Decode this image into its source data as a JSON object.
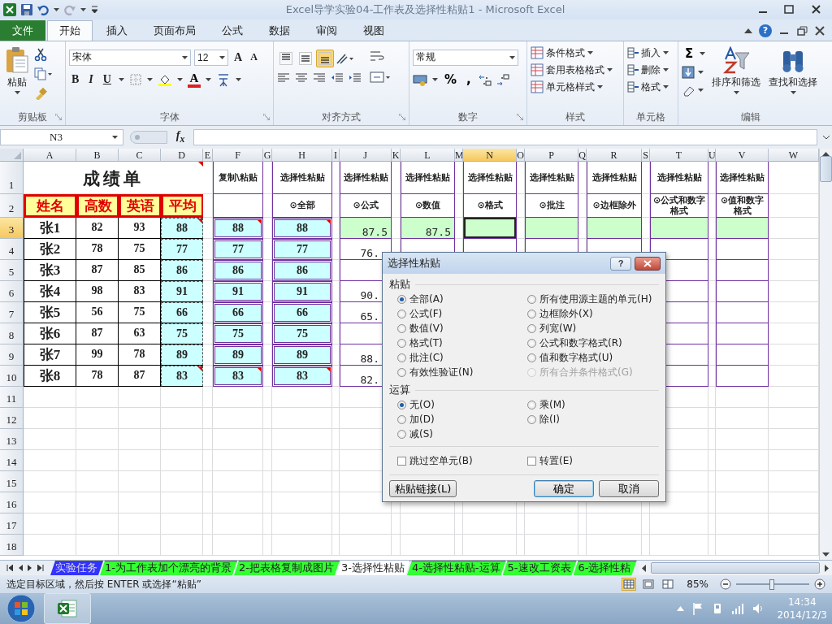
{
  "window": {
    "title": "Excel导学实验04-工作表及选择性粘贴1 - Microsoft Excel"
  },
  "ribbon_tabs": [
    {
      "label": "文件",
      "kind": "file",
      "selected": false
    },
    {
      "label": "开始",
      "kind": "tab",
      "selected": true
    },
    {
      "label": "插入",
      "kind": "tab",
      "selected": false
    },
    {
      "label": "页面布局",
      "kind": "tab",
      "selected": false
    },
    {
      "label": "公式",
      "kind": "tab",
      "selected": false
    },
    {
      "label": "数据",
      "kind": "tab",
      "selected": false
    },
    {
      "label": "审阅",
      "kind": "tab",
      "selected": false
    },
    {
      "label": "视图",
      "kind": "tab",
      "selected": false
    }
  ],
  "help": "?",
  "ribbon": {
    "clipboard": {
      "label": "剪贴板",
      "paste": "粘贴"
    },
    "font": {
      "label": "字体",
      "font_name": "宋体",
      "font_size": "12",
      "grow": "A",
      "shrink": "A",
      "bold": "B",
      "italic": "I",
      "underline": "U",
      "font_color": "A"
    },
    "alignment": {
      "label": "对齐方式",
      "vertical": [
        {
          "kind": "top",
          "selected": false
        },
        {
          "kind": "middle",
          "selected": false
        },
        {
          "kind": "bottom",
          "selected": true
        }
      ]
    },
    "number": {
      "label": "数字",
      "format": "常规",
      "percent": "%",
      "comma": ","
    },
    "styles": {
      "label": "样式",
      "items": [
        "条件格式",
        "套用表格格式",
        "单元格样式"
      ]
    },
    "cells": {
      "label": "单元格",
      "items": [
        "插入",
        "删除",
        "格式"
      ]
    },
    "editing": {
      "label": "编辑",
      "sum": "Σ",
      "sort": "排序和筛选",
      "find": "查找和选择"
    }
  },
  "formula_bar": {
    "name_box": "N3",
    "fx": "f$_{x}$"
  },
  "sheet": {
    "columns": [
      {
        "label": "A",
        "selected": false
      },
      {
        "label": "B",
        "selected": false
      },
      {
        "label": "C",
        "selected": false
      },
      {
        "label": "D",
        "selected": false
      },
      {
        "label": "E",
        "selected": false
      },
      {
        "label": "F",
        "selected": false
      },
      {
        "label": "G",
        "selected": false
      },
      {
        "label": "H",
        "selected": false
      },
      {
        "label": "I",
        "selected": false
      },
      {
        "label": "J",
        "selected": false
      },
      {
        "label": "K",
        "selected": false
      },
      {
        "label": "L",
        "selected": false
      },
      {
        "label": "M",
        "selected": false
      },
      {
        "label": "N",
        "selected": true
      },
      {
        "label": "O",
        "selected": false
      },
      {
        "label": "P",
        "selected": false
      },
      {
        "label": "Q",
        "selected": false
      },
      {
        "label": "R",
        "selected": false
      },
      {
        "label": "S",
        "selected": false
      },
      {
        "label": "T",
        "selected": false
      },
      {
        "label": "U",
        "selected": false
      },
      {
        "label": "V",
        "selected": false
      },
      {
        "label": "W",
        "selected": false
      }
    ],
    "rows": [
      {
        "label": "1",
        "selected": false,
        "cells": [
          {
            "kind": "title",
            "text": "成绩单",
            "comment": true
          },
          {
            "kind": "blank"
          },
          {
            "kind": "label",
            "text": "复制\\粘贴"
          },
          {
            "kind": "blank"
          },
          {
            "kind": "label",
            "text": "选择性粘贴"
          },
          {
            "kind": "blank"
          },
          {
            "kind": "label",
            "text": "选择性粘贴"
          },
          {
            "kind": "blank"
          },
          {
            "kind": "label",
            "text": "选择性粘贴"
          },
          {
            "kind": "blank"
          },
          {
            "kind": "label",
            "text": "选择性粘贴"
          },
          {
            "kind": "blank"
          },
          {
            "kind": "label",
            "text": "选择性粘贴"
          },
          {
            "kind": "blank"
          },
          {
            "kind": "label",
            "text": "选择性粘贴"
          },
          {
            "kind": "blank"
          },
          {
            "kind": "label",
            "text": "选择性粘贴"
          },
          {
            "kind": "blank"
          },
          {
            "kind": "label",
            "text": "选择性粘贴"
          },
          {
            "kind": "blank"
          }
        ]
      },
      {
        "label": "2",
        "selected": false,
        "cells": [
          {
            "kind": "header",
            "text": "姓名"
          },
          {
            "kind": "header",
            "text": "高数"
          },
          {
            "kind": "header",
            "text": "英语"
          },
          {
            "kind": "header",
            "text": "平均"
          },
          {
            "kind": "blank"
          },
          {
            "kind": "box"
          },
          {
            "kind": "blank"
          },
          {
            "kind": "option",
            "text": "⊙全部"
          },
          {
            "kind": "blank"
          },
          {
            "kind": "option",
            "text": "⊙公式"
          },
          {
            "kind": "blank"
          },
          {
            "kind": "option",
            "text": "⊙数值"
          },
          {
            "kind": "blank"
          },
          {
            "kind": "option",
            "text": "⊙格式"
          },
          {
            "kind": "blank"
          },
          {
            "kind": "option",
            "text": "⊙批注"
          },
          {
            "kind": "blank"
          },
          {
            "kind": "option",
            "text": "⊙边框除外"
          },
          {
            "kind": "blank"
          },
          {
            "kind": "option",
            "text": "⊙公式和数字格式"
          },
          {
            "kind": "blank"
          },
          {
            "kind": "option",
            "text": "⊙值和数字格式"
          },
          {
            "kind": "blank"
          }
        ]
      },
      {
        "label": "3",
        "selected": true,
        "cells": [
          {
            "kind": "name",
            "text": "张1"
          },
          {
            "kind": "score",
            "text": "82"
          },
          {
            "kind": "score",
            "text": "93"
          },
          {
            "kind": "avg",
            "text": "88",
            "comment": true
          },
          {
            "kind": "blank"
          },
          {
            "kind": "copy",
            "text": "88",
            "comment": true
          },
          {
            "kind": "blank"
          },
          {
            "kind": "copy",
            "text": "88",
            "comment": true
          },
          {
            "kind": "blank"
          },
          {
            "kind": "green",
            "text": "87.5"
          },
          {
            "kind": "blank"
          },
          {
            "kind": "green",
            "text": "87.5"
          },
          {
            "kind": "blank"
          },
          {
            "kind": "green"
          },
          {
            "kind": "blank"
          },
          {
            "kind": "green"
          },
          {
            "kind": "blank"
          },
          {
            "kind": "green"
          },
          {
            "kind": "blank"
          },
          {
            "kind": "green"
          },
          {
            "kind": "blank"
          },
          {
            "kind": "green"
          },
          {
            "kind": "blank"
          }
        ]
      },
      {
        "label": "4",
        "selected": false,
        "cells": [
          {
            "kind": "name",
            "text": "张2"
          },
          {
            "kind": "score",
            "text": "78"
          },
          {
            "kind": "score",
            "text": "75"
          },
          {
            "kind": "avg",
            "text": "77",
            "comment": false
          },
          {
            "kind": "blank"
          },
          {
            "kind": "copy",
            "text": "77",
            "comment": false
          },
          {
            "kind": "blank"
          },
          {
            "kind": "copy",
            "text": "77",
            "comment": false
          },
          {
            "kind": "blank"
          },
          {
            "kind": "number",
            "text": "76."
          },
          {
            "kind": "blank"
          },
          {
            "kind": "box"
          },
          {
            "kind": "blank"
          },
          {
            "kind": "box"
          },
          {
            "kind": "blank"
          },
          {
            "kind": "box"
          },
          {
            "kind": "blank"
          },
          {
            "kind": "box"
          },
          {
            "kind": "blank"
          },
          {
            "kind": "box"
          },
          {
            "kind": "blank"
          },
          {
            "kind": "box"
          },
          {
            "kind": "blank"
          }
        ]
      },
      {
        "label": "5",
        "selected": false,
        "cells": [
          {
            "kind": "name",
            "text": "张3"
          },
          {
            "kind": "score",
            "text": "87"
          },
          {
            "kind": "score",
            "text": "85"
          },
          {
            "kind": "avg",
            "text": "86",
            "comment": false
          },
          {
            "kind": "blank"
          },
          {
            "kind": "copy",
            "text": "86",
            "comment": false
          },
          {
            "kind": "blank"
          },
          {
            "kind": "copy",
            "text": "86",
            "comment": false
          },
          {
            "kind": "blank"
          },
          {
            "kind": "box"
          },
          {
            "kind": "blank"
          },
          {
            "kind": "box"
          },
          {
            "kind": "blank"
          },
          {
            "kind": "box"
          },
          {
            "kind": "blank"
          },
          {
            "kind": "box"
          },
          {
            "kind": "blank"
          },
          {
            "kind": "box"
          },
          {
            "kind": "blank"
          },
          {
            "kind": "box"
          },
          {
            "kind": "blank"
          },
          {
            "kind": "box"
          },
          {
            "kind": "blank"
          }
        ]
      },
      {
        "label": "6",
        "selected": false,
        "cells": [
          {
            "kind": "name",
            "text": "张4"
          },
          {
            "kind": "score",
            "text": "98"
          },
          {
            "kind": "score",
            "text": "83"
          },
          {
            "kind": "avg",
            "text": "91",
            "comment": false
          },
          {
            "kind": "blank"
          },
          {
            "kind": "copy",
            "text": "91",
            "comment": false
          },
          {
            "kind": "blank"
          },
          {
            "kind": "copy",
            "text": "91",
            "comment": false
          },
          {
            "kind": "blank"
          },
          {
            "kind": "number",
            "text": "90."
          },
          {
            "kind": "blank"
          },
          {
            "kind": "box"
          },
          {
            "kind": "blank"
          },
          {
            "kind": "box"
          },
          {
            "kind": "blank"
          },
          {
            "kind": "box"
          },
          {
            "kind": "blank"
          },
          {
            "kind": "box"
          },
          {
            "kind": "blank"
          },
          {
            "kind": "box"
          },
          {
            "kind": "blank"
          },
          {
            "kind": "box"
          },
          {
            "kind": "blank"
          }
        ]
      },
      {
        "label": "7",
        "selected": false,
        "cells": [
          {
            "kind": "name",
            "text": "张5"
          },
          {
            "kind": "score",
            "text": "56"
          },
          {
            "kind": "score",
            "text": "75"
          },
          {
            "kind": "avg",
            "text": "66",
            "comment": false
          },
          {
            "kind": "blank"
          },
          {
            "kind": "copy",
            "text": "66",
            "comment": false
          },
          {
            "kind": "blank"
          },
          {
            "kind": "copy",
            "text": "66",
            "comment": false
          },
          {
            "kind": "blank"
          },
          {
            "kind": "number",
            "text": "65."
          },
          {
            "kind": "blank"
          },
          {
            "kind": "box"
          },
          {
            "kind": "blank"
          },
          {
            "kind": "box"
          },
          {
            "kind": "blank"
          },
          {
            "kind": "box"
          },
          {
            "kind": "blank"
          },
          {
            "kind": "box"
          },
          {
            "kind": "blank"
          },
          {
            "kind": "box"
          },
          {
            "kind": "blank"
          },
          {
            "kind": "box"
          },
          {
            "kind": "blank"
          }
        ]
      },
      {
        "label": "8",
        "selected": false,
        "cells": [
          {
            "kind": "name",
            "text": "张6"
          },
          {
            "kind": "score",
            "text": "87"
          },
          {
            "kind": "score",
            "text": "63"
          },
          {
            "kind": "avg",
            "text": "75",
            "comment": false
          },
          {
            "kind": "blank"
          },
          {
            "kind": "copy",
            "text": "75",
            "comment": false
          },
          {
            "kind": "blank"
          },
          {
            "kind": "copy",
            "text": "75",
            "comment": false
          },
          {
            "kind": "blank"
          },
          {
            "kind": "box"
          },
          {
            "kind": "blank"
          },
          {
            "kind": "box"
          },
          {
            "kind": "blank"
          },
          {
            "kind": "box"
          },
          {
            "kind": "blank"
          },
          {
            "kind": "box"
          },
          {
            "kind": "blank"
          },
          {
            "kind": "box"
          },
          {
            "kind": "blank"
          },
          {
            "kind": "box"
          },
          {
            "kind": "blank"
          },
          {
            "kind": "box"
          },
          {
            "kind": "blank"
          }
        ]
      },
      {
        "label": "9",
        "selected": false,
        "cells": [
          {
            "kind": "name",
            "text": "张7"
          },
          {
            "kind": "score",
            "text": "99"
          },
          {
            "kind": "score",
            "text": "78"
          },
          {
            "kind": "avg",
            "text": "89",
            "comment": false
          },
          {
            "kind": "blank"
          },
          {
            "kind": "copy",
            "text": "89",
            "comment": false
          },
          {
            "kind": "blank"
          },
          {
            "kind": "copy",
            "text": "89",
            "comment": false
          },
          {
            "kind": "blank"
          },
          {
            "kind": "number",
            "text": "88."
          },
          {
            "kind": "blank"
          },
          {
            "kind": "box"
          },
          {
            "kind": "blank"
          },
          {
            "kind": "box"
          },
          {
            "kind": "blank"
          },
          {
            "kind": "box"
          },
          {
            "kind": "blank"
          },
          {
            "kind": "box"
          },
          {
            "kind": "blank"
          },
          {
            "kind": "box"
          },
          {
            "kind": "blank"
          },
          {
            "kind": "box"
          },
          {
            "kind": "blank"
          }
        ]
      },
      {
        "label": "10",
        "selected": false,
        "cells": [
          {
            "kind": "name",
            "text": "张8"
          },
          {
            "kind": "score",
            "text": "78"
          },
          {
            "kind": "score",
            "text": "87"
          },
          {
            "kind": "avg",
            "text": "83",
            "comment": true
          },
          {
            "kind": "blank"
          },
          {
            "kind": "copy",
            "text": "83",
            "comment": true
          },
          {
            "kind": "blank"
          },
          {
            "kind": "copy",
            "text": "83",
            "comment": true
          },
          {
            "kind": "blank"
          },
          {
            "kind": "number",
            "text": "82."
          },
          {
            "kind": "blank"
          },
          {
            "kind": "box"
          },
          {
            "kind": "blank"
          },
          {
            "kind": "box"
          },
          {
            "kind": "blank"
          },
          {
            "kind": "box"
          },
          {
            "kind": "blank"
          },
          {
            "kind": "box"
          },
          {
            "kind": "blank"
          },
          {
            "kind": "box"
          },
          {
            "kind": "blank"
          },
          {
            "kind": "box"
          },
          {
            "kind": "blank"
          }
        ]
      },
      {
        "label": "11",
        "selected": false
      },
      {
        "label": "12",
        "selected": false
      },
      {
        "label": "13",
        "selected": false
      },
      {
        "label": "14",
        "selected": false
      },
      {
        "label": "15",
        "selected": false
      },
      {
        "label": "16",
        "selected": false
      },
      {
        "label": "17",
        "selected": false
      },
      {
        "label": "18",
        "selected": false
      }
    ]
  },
  "sheet_tabs": [
    {
      "label": "实验任务",
      "color": "#3333ff",
      "selected": false
    },
    {
      "label": "1-为工作表加个漂亮的背景",
      "color": "#33ff33",
      "selected": false
    },
    {
      "label": "2-把表格复制成图片",
      "color": "#33ff33",
      "selected": false
    },
    {
      "label": "3-选择性粘贴",
      "color": "#ffffff",
      "selected": true
    },
    {
      "label": "4-选择性粘贴-运算",
      "color": "#33ff33",
      "selected": false
    },
    {
      "label": "5-速改工资表",
      "color": "#33ff33",
      "selected": false
    },
    {
      "label": "6-选择性粘",
      "color": "#33ff33",
      "selected": false
    }
  ],
  "status_bar": {
    "message": "选定目标区域，然后按 ENTER 或选择“粘贴”",
    "views": [
      {
        "kind": "normal",
        "selected": true
      },
      {
        "kind": "layout",
        "selected": false
      },
      {
        "kind": "break",
        "selected": false
      }
    ],
    "zoom": "85%",
    "zoom_slider": {
      "level": 0.5
    }
  },
  "dialog": {
    "title": "选择性粘贴",
    "help": "?",
    "paste_label": "粘贴",
    "paste_options": [
      {
        "label": "全部(A)",
        "selected": true,
        "disabled": false
      },
      {
        "label": "公式(F)",
        "selected": false,
        "disabled": false
      },
      {
        "label": "数值(V)",
        "selected": false,
        "disabled": false
      },
      {
        "label": "格式(T)",
        "selected": false,
        "disabled": false
      },
      {
        "label": "批注(C)",
        "selected": false,
        "disabled": false
      },
      {
        "label": "有效性验证(N)",
        "selected": false,
        "disabled": false
      },
      {
        "label": "所有使用源主题的单元(H)",
        "selected": false,
        "disabled": false
      },
      {
        "label": "边框除外(X)",
        "selected": false,
        "disabled": false
      },
      {
        "label": "列宽(W)",
        "selected": false,
        "disabled": false
      },
      {
        "label": "公式和数字格式(R)",
        "selected": false,
        "disabled": false
      },
      {
        "label": "值和数字格式(U)",
        "selected": false,
        "disabled": false
      },
      {
        "label": "所有合并条件格式(G)",
        "selected": false,
        "disabled": true
      }
    ],
    "operation_label": "运算",
    "operation_options": [
      {
        "label": "无(O)",
        "selected": true
      },
      {
        "label": "加(D)",
        "selected": false
      },
      {
        "label": "减(S)",
        "selected": false
      },
      {
        "label": "乘(M)",
        "selected": false
      },
      {
        "label": "除(I)",
        "selected": false
      }
    ],
    "checkboxes": [
      {
        "label": "跳过空单元(B)",
        "checked": false
      },
      {
        "label": "转置(E)",
        "checked": false
      }
    ],
    "buttons": [
      {
        "label": "粘贴链接(L)",
        "default": false
      },
      {
        "label": "确定",
        "default": true
      },
      {
        "label": "取消",
        "default": false
      }
    ]
  },
  "taskbar": {
    "time": "14:34",
    "date": "2014/12/3"
  }
}
